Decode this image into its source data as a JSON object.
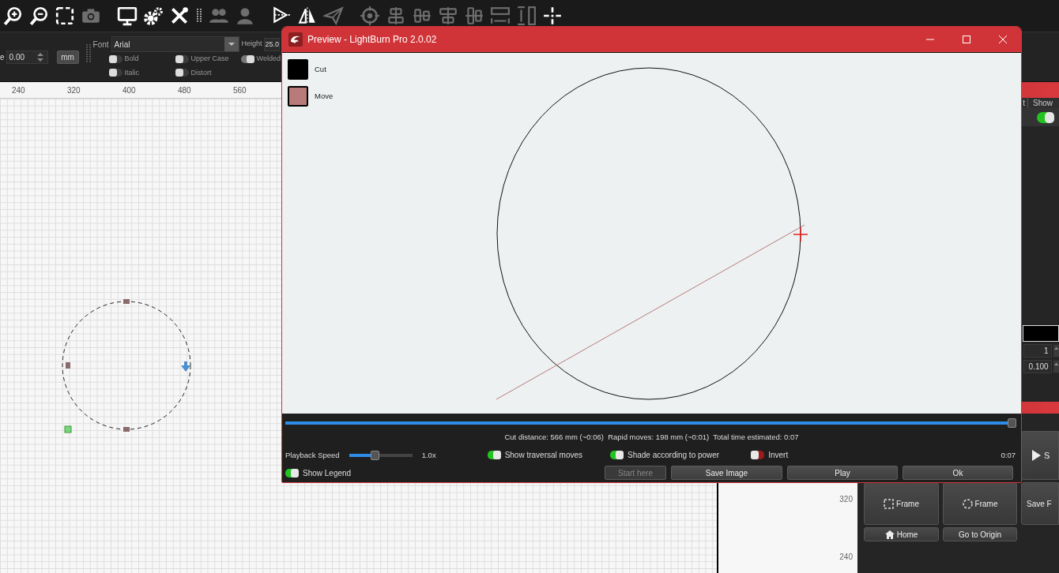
{
  "toolbar": {
    "buttons": [
      {
        "kind": "zoom-in",
        "disabled": false
      },
      {
        "kind": "zoom-out",
        "disabled": false
      },
      {
        "kind": "select",
        "disabled": false
      },
      {
        "kind": "camera",
        "disabled": true
      },
      {
        "kind": "monitor",
        "disabled": false
      },
      {
        "kind": "gears",
        "disabled": false
      },
      {
        "kind": "tools",
        "disabled": false
      },
      {
        "kind": "grip",
        "disabled": false
      },
      {
        "kind": "people",
        "disabled": true
      },
      {
        "kind": "person",
        "disabled": true
      },
      {
        "kind": "mirror",
        "disabled": false
      },
      {
        "kind": "flip",
        "disabled": false
      },
      {
        "kind": "plane",
        "disabled": true
      },
      {
        "kind": "target",
        "disabled": true
      },
      {
        "kind": "align-a",
        "disabled": true
      },
      {
        "kind": "align-b",
        "disabled": true
      },
      {
        "kind": "align-c",
        "disabled": true
      },
      {
        "kind": "align-d",
        "disabled": true
      },
      {
        "kind": "dist-h",
        "disabled": true
      },
      {
        "kind": "dist-v",
        "disabled": true
      },
      {
        "kind": "crosshair",
        "disabled": false
      }
    ]
  },
  "text_options": {
    "spacing_label": "e",
    "spacing_value": "0.00",
    "unit_button": "mm",
    "font_label": "Font",
    "font_value": "Arial",
    "height_label": "Height",
    "height_value": "25.0",
    "toggles": [
      {
        "label": "Bold",
        "checked": false
      },
      {
        "label": "Upper Case",
        "checked": false
      },
      {
        "label": "Welded",
        "checked": true
      },
      {
        "label": "Italic",
        "checked": false
      },
      {
        "label": "Distort",
        "checked": false
      }
    ]
  },
  "ruler": {
    "x_ticks": [
      "240",
      "320",
      "400",
      "480",
      "560"
    ],
    "y_ticks": [
      "320",
      "240"
    ]
  },
  "layers_panel": {
    "columns": [
      "t",
      "Show"
    ],
    "rows": [
      {
        "show": true
      }
    ],
    "fields": [
      "1",
      "0.100"
    ]
  },
  "laser_panel": {
    "buttons": [
      {
        "label": "S",
        "kind": "start"
      },
      {
        "label": "Frame",
        "kind": "frame-rect"
      },
      {
        "label": "Frame",
        "kind": "frame-circle"
      },
      {
        "label": "Save F",
        "kind": "plain"
      },
      {
        "label": "Home",
        "kind": "home"
      },
      {
        "label": "Go to Origin",
        "kind": "plain"
      }
    ]
  },
  "preview": {
    "title": "Preview - LightBurn Pro 2.0.02",
    "legend": [
      {
        "label": "Cut",
        "color": "#000000"
      },
      {
        "label": "Move",
        "color": "#b97a7a"
      }
    ],
    "progress": {
      "level": 1.0
    },
    "stats": "Cut distance: 566 mm (~0:06)  Rapid moves: 198 mm (~0:01)  Total time estimated: 0:07",
    "playback": {
      "label": "Playback Speed",
      "level": 0.39,
      "reading": "1.0x"
    },
    "toggles": [
      {
        "label": "Show traversal moves",
        "on": true
      },
      {
        "label": "Shade according to power",
        "on": true
      },
      {
        "label": "Invert",
        "on": false
      }
    ],
    "time": "0:07",
    "show_legend": {
      "label": "Show Legend",
      "on": true
    },
    "buttons": [
      {
        "label": "Start here",
        "disabled": true
      },
      {
        "label": "Save Image",
        "disabled": false
      },
      {
        "label": "Play",
        "disabled": false
      },
      {
        "label": "Ok",
        "disabled": false
      }
    ]
  }
}
